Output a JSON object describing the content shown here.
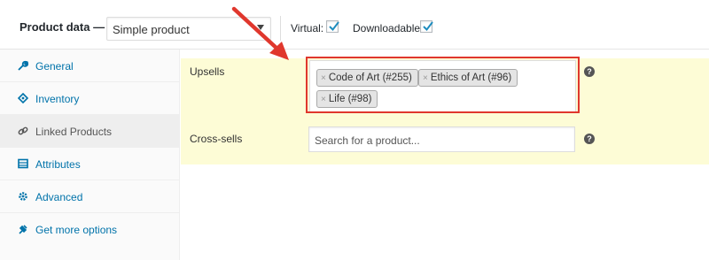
{
  "header": {
    "title": "Product data —",
    "product_type": "Simple product",
    "virtual_label": "Virtual:",
    "downloadable_label": "Downloadable:"
  },
  "sidebar": {
    "items": [
      {
        "label": "General",
        "icon": "wrench-icon"
      },
      {
        "label": "Inventory",
        "icon": "tag-icon"
      },
      {
        "label": "Linked Products",
        "icon": "link-icon"
      },
      {
        "label": "Attributes",
        "icon": "table-icon"
      },
      {
        "label": "Advanced",
        "icon": "gear-icon"
      },
      {
        "label": "Get more options",
        "icon": "plugin-icon"
      }
    ]
  },
  "linked": {
    "upsells_label": "Upsells",
    "upsells": [
      "Code of Art (#255)",
      "Ethics of Art (#96)",
      "Life (#98)"
    ],
    "cross_sells_label": "Cross-sells",
    "cross_sells_placeholder": "Search for a product...",
    "help_glyph": "?",
    "remove_glyph": "×"
  },
  "colors": {
    "link": "#0073aa",
    "highlight_row": "#fdfcd6",
    "annotation_red": "#e0372d",
    "check": "#1e8cbe"
  }
}
